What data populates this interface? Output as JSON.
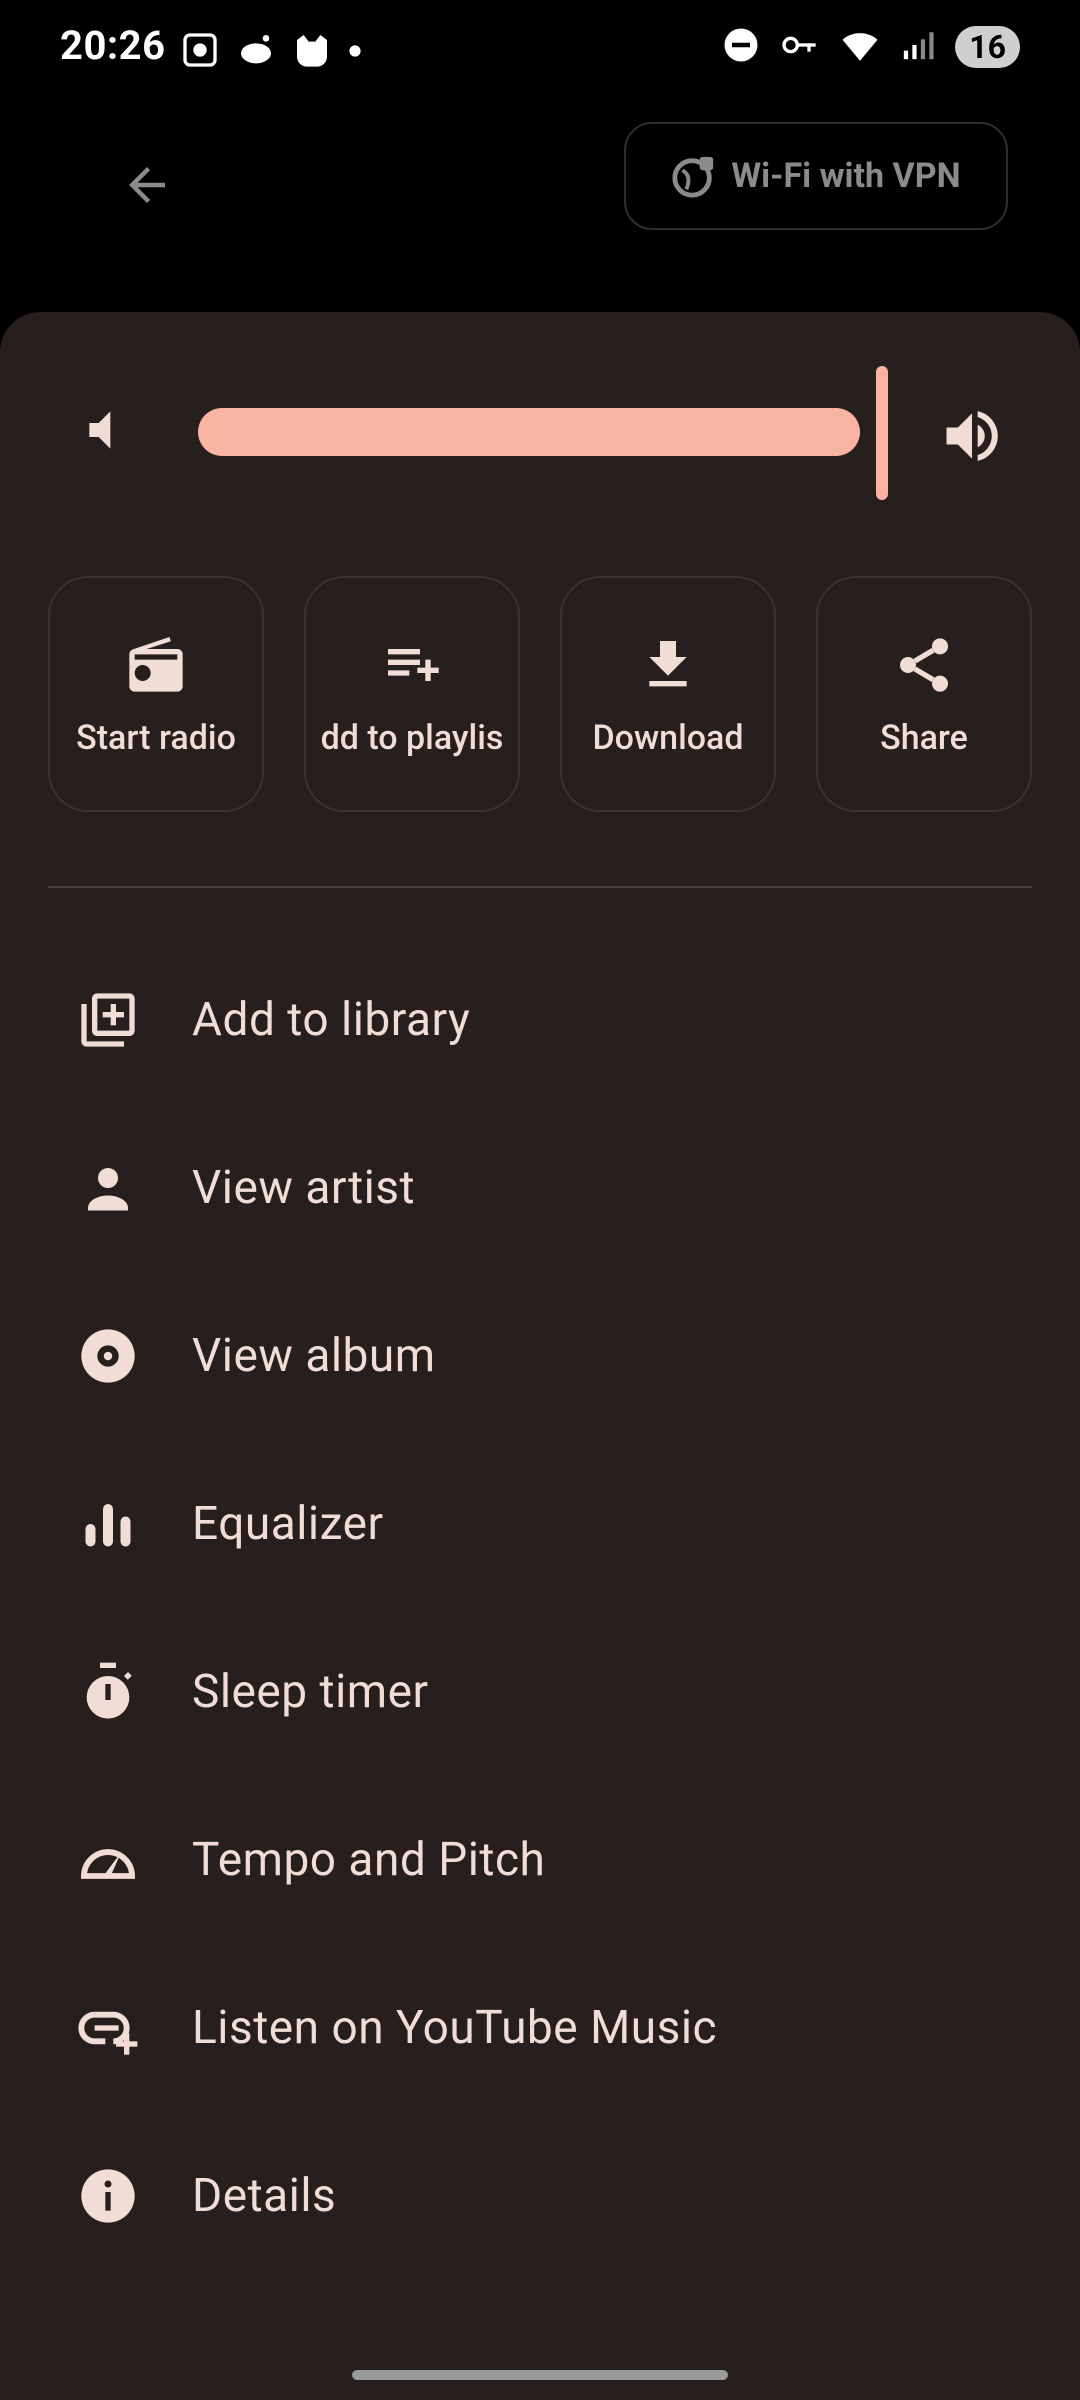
{
  "status_bar": {
    "time": "20:26",
    "battery": "16"
  },
  "header": {
    "network_chip": "Wi-Fi with VPN"
  },
  "colors": {
    "accent": "#f8b4a0",
    "sheet_bg": "#261f1d",
    "text": "#f1dcd6"
  },
  "volume": {
    "level": 0.97
  },
  "actions": [
    {
      "label": "Start radio",
      "icon": "radio-icon"
    },
    {
      "label": "dd to playlis",
      "icon": "playlist-add-icon"
    },
    {
      "label": "Download",
      "icon": "download-icon"
    },
    {
      "label": "Share",
      "icon": "share-icon"
    }
  ],
  "menu": [
    {
      "label": "Add to library",
      "icon": "library-add-icon"
    },
    {
      "label": "View artist",
      "icon": "person-icon"
    },
    {
      "label": "View album",
      "icon": "album-icon"
    },
    {
      "label": "Equalizer",
      "icon": "equalizer-icon"
    },
    {
      "label": "Sleep timer",
      "icon": "timer-icon"
    },
    {
      "label": "Tempo and Pitch",
      "icon": "speed-icon"
    },
    {
      "label": "Listen on YouTube Music",
      "icon": "link-add-icon"
    },
    {
      "label": "Details",
      "icon": "info-icon"
    }
  ]
}
